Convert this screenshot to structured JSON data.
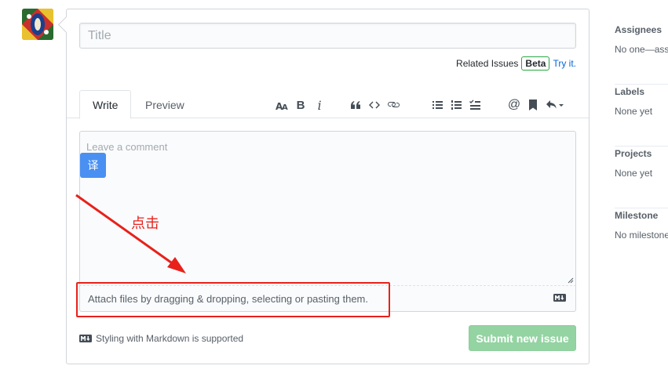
{
  "title_input": {
    "placeholder": "Title",
    "value": ""
  },
  "related": {
    "label": "Related Issues",
    "badge": "Beta",
    "link": "Try it."
  },
  "tabs": [
    {
      "label": "Write"
    },
    {
      "label": "Preview"
    }
  ],
  "toolbar": {
    "icons": [
      "text-size-icon",
      "bold-icon",
      "italic-icon",
      "quote-icon",
      "code-icon",
      "link-icon",
      "unordered-list-icon",
      "ordered-list-icon",
      "task-list-icon",
      "mention-icon",
      "reference-icon",
      "reply-icon"
    ],
    "bold_label": "B",
    "italic_label": "i",
    "mention_label": "@"
  },
  "comment": {
    "placeholder": "Leave a comment",
    "value": ""
  },
  "translate_button": {
    "label": "译"
  },
  "attach": {
    "text": "Attach files by dragging & dropping, selecting or pasting them."
  },
  "annotation": {
    "text": "点击",
    "color": "#e8211b"
  },
  "markdown_note": {
    "text": "Styling with Markdown is supported"
  },
  "submit": {
    "label": "Submit new issue",
    "color": "#94d3a2"
  },
  "sidebar": {
    "sections": [
      {
        "heading": "Assignees",
        "value": "No one—assign yourself"
      },
      {
        "heading": "Labels",
        "value": "None yet"
      },
      {
        "heading": "Projects",
        "value": "None yet"
      },
      {
        "heading": "Milestone",
        "value": "No milestone"
      }
    ]
  }
}
